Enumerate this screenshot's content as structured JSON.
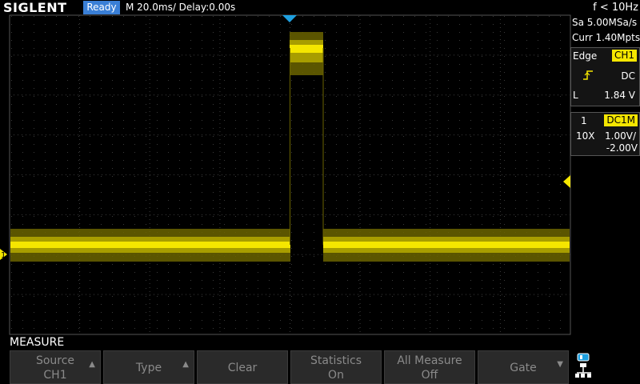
{
  "header": {
    "brand": "SIGLENT",
    "status": "Ready",
    "timebase": "M 20.0ms/ Delay:0.00s",
    "frequency": "f < 10Hz"
  },
  "acquisition": {
    "sample_rate": "Sa 5.00MSa/s",
    "memory_depth": "Curr 1.40Mpts"
  },
  "trigger": {
    "type": "Edge",
    "source": "CH1",
    "coupling": "DC",
    "level_label": "L",
    "level": "1.84 V"
  },
  "channel": {
    "number": "1",
    "coupling_impedance": "DC1M",
    "probe": "10X",
    "scale": "1.00V/",
    "offset": "-2.00V"
  },
  "menu": {
    "title": "MEASURE",
    "softkeys": [
      {
        "line1": "Source",
        "line2": "CH1"
      },
      {
        "line1": "Type",
        "line2": ""
      },
      {
        "line1": "Clear",
        "line2": ""
      },
      {
        "line1": "Statistics",
        "line2": "On"
      },
      {
        "line1": "All Measure",
        "line2": "Off"
      },
      {
        "line1": "Gate",
        "line2": ""
      }
    ]
  },
  "markers": {
    "channel_marker": "1"
  },
  "colors": {
    "trace": "#f5e600",
    "status_badge": "#3a7fd6",
    "trigger_position": "#1ea0e0"
  }
}
